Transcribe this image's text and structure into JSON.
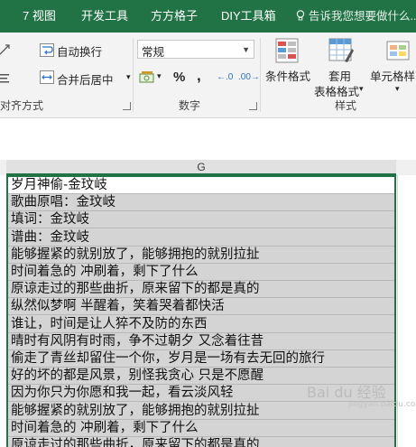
{
  "tabs": [
    "7 视图",
    "开发工具",
    "方方格子",
    "DIY工具箱"
  ],
  "tell_me": "告诉我您想要做什么...",
  "ribbon": {
    "wrap_text": "自动换行",
    "merge_center": "合并后居中",
    "alignment_group": "对齐方式",
    "number_format_value": "常规",
    "percent_symbol": "%",
    "comma_symbol": ",",
    "inc_decimal": "←.0",
    "dec_decimal": ".00→",
    "number_group": "数字",
    "cond_format": "条件格式",
    "format_as_table_1": "套用",
    "format_as_table_2": "表格格式",
    "cell_styles": "单元格样",
    "styles_group": "样式"
  },
  "sheet": {
    "column_header": "G",
    "rows": [
      "岁月神偷-金玟岐",
      "歌曲原唱：金玟岐",
      "填词：金玟岐",
      "谱曲：金玟岐",
      "能够握紧的就别放了，能够拥抱的就别拉扯",
      "时间着急的 冲刷着，剩下了什么",
      "原谅走过的那些曲折，原来留下的都是真的",
      "纵然似梦啊 半醒着，笑着哭着都快活",
      "谁让，时间是让人猝不及防的东西",
      "晴时有风阴有时雨，争不过朝夕 又念着往昔",
      "偷走了青丝却留住一个你，岁月是一场有去无回的旅行",
      "好的坏的都是风景，别怪我贪心 只是不愿醒",
      "因为你只为你愿和我一起，看云淡风轻",
      "能够握紧的就别放了，能够拥抱的就别拉扯",
      "时间着急的 冲刷着，剩下了什么",
      "原谅走过的那些曲折，原来留下的都是真的"
    ]
  },
  "watermark": {
    "text": "Bai du 经验",
    "sub": "jingyan.baidu.com"
  },
  "colors": {
    "accent": "#217346",
    "selection": "#d4d4d4"
  }
}
